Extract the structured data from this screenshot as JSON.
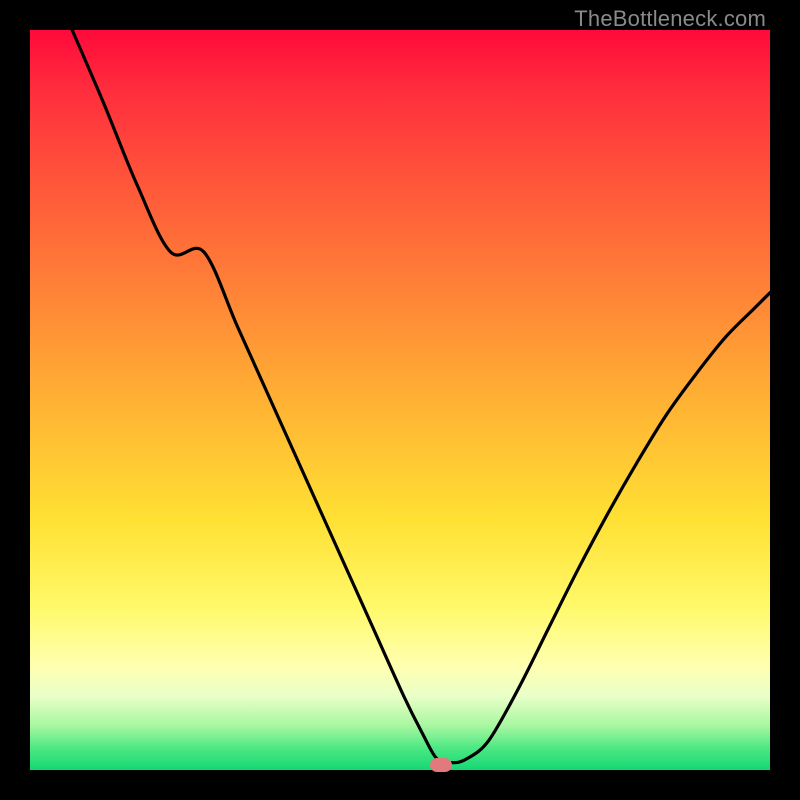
{
  "watermark": "TheBottleneck.com",
  "marker": {
    "x_frac": 0.555,
    "y_frac": 0.993
  },
  "colors": {
    "curve_stroke": "#000000",
    "marker_fill": "#e07a7d"
  },
  "chart_data": {
    "type": "line",
    "title": "",
    "xlabel": "",
    "ylabel": "",
    "xlim": [
      0,
      1
    ],
    "ylim": [
      0,
      1
    ],
    "series": [
      {
        "name": "curve",
        "x": [
          0.057,
          0.1,
          0.145,
          0.19,
          0.235,
          0.28,
          0.325,
          0.37,
          0.415,
          0.46,
          0.505,
          0.53,
          0.55,
          0.57,
          0.59,
          0.62,
          0.66,
          0.7,
          0.74,
          0.78,
          0.82,
          0.86,
          0.9,
          0.94,
          0.98,
          1.0
        ],
        "y": [
          1.0,
          0.9,
          0.79,
          0.7,
          0.7,
          0.6,
          0.5,
          0.4,
          0.3,
          0.2,
          0.1,
          0.05,
          0.015,
          0.01,
          0.015,
          0.04,
          0.11,
          0.19,
          0.27,
          0.345,
          0.415,
          0.48,
          0.535,
          0.585,
          0.625,
          0.645
        ]
      }
    ],
    "annotations": [
      {
        "type": "marker",
        "x": 0.555,
        "y": 0.007
      }
    ]
  }
}
